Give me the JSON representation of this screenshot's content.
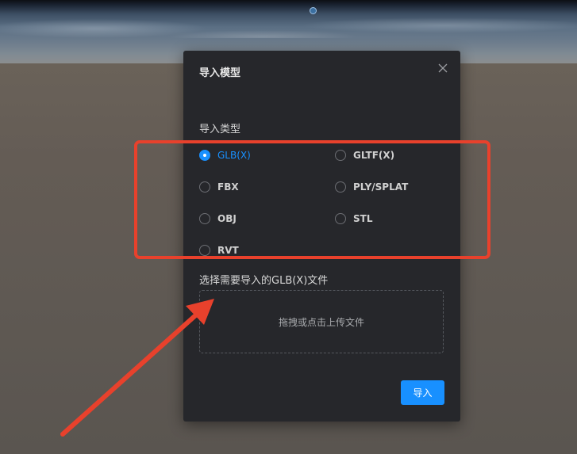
{
  "dialog": {
    "title": "导入模型",
    "import_type_label": "导入类型",
    "options": [
      {
        "label": "GLB(X)",
        "checked": true
      },
      {
        "label": "GLTF(X)",
        "checked": false
      },
      {
        "label": "FBX",
        "checked": false
      },
      {
        "label": "PLY/SPLAT",
        "checked": false
      },
      {
        "label": "OBJ",
        "checked": false
      },
      {
        "label": "STL",
        "checked": false
      },
      {
        "label": "RVT",
        "checked": false
      }
    ],
    "select_file_label": "选择需要导入的GLB(X)文件",
    "upload_hint": "拖拽或点击上传文件",
    "import_button": "导入"
  },
  "colors": {
    "accent": "#1890ff",
    "dialog_bg": "#26272b",
    "annotation": "#e8412c"
  },
  "icons": {
    "close": "close-icon"
  }
}
